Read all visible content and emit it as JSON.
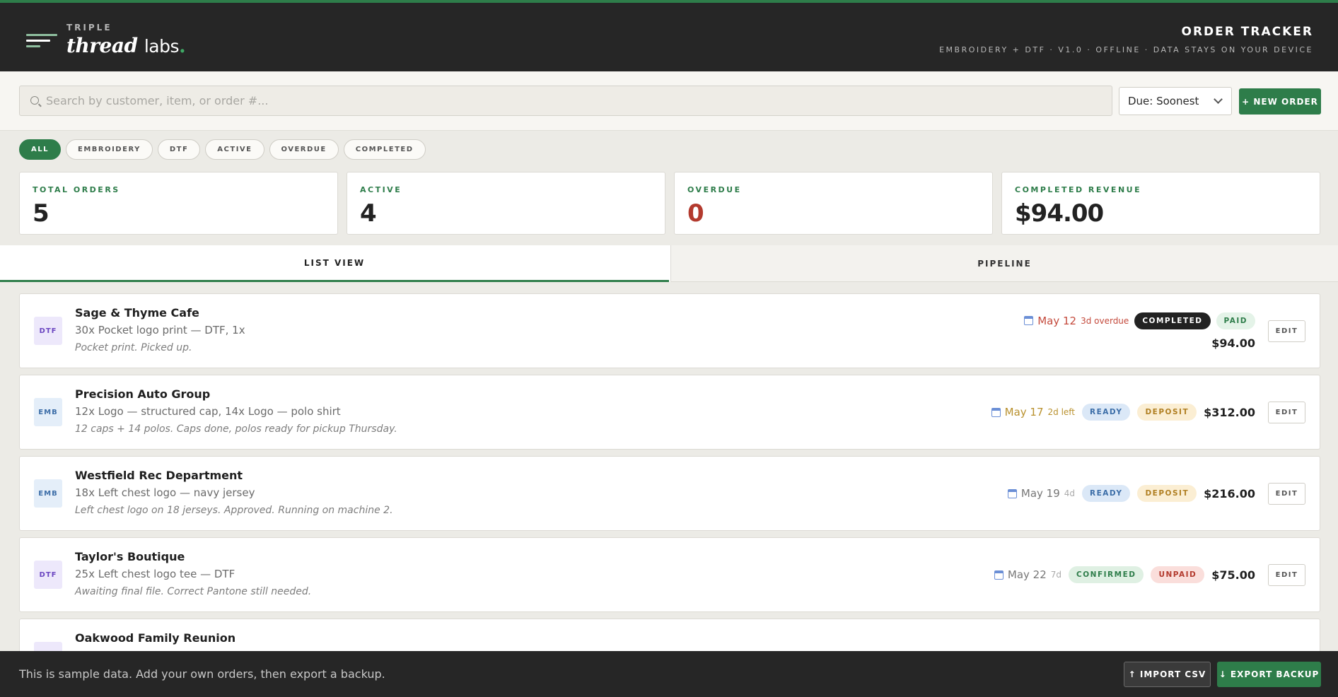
{
  "brand": {
    "top": "TRIPLE",
    "thread": "thread",
    "labs": "labs",
    "dot": "."
  },
  "header": {
    "title": "ORDER TRACKER",
    "subtitle": "EMBROIDERY + DTF · V1.0 · OFFLINE · DATA STAYS ON YOUR DEVICE"
  },
  "search": {
    "placeholder": "Search by customer, item, or order #...",
    "value": ""
  },
  "sort": {
    "selected": "Due: Soonest"
  },
  "actions": {
    "new_order": "+ NEW ORDER"
  },
  "filters": [
    "ALL",
    "EMBROIDERY",
    "DTF",
    "ACTIVE",
    "OVERDUE",
    "COMPLETED"
  ],
  "active_filter": "ALL",
  "stats": [
    {
      "label": "TOTAL ORDERS",
      "value": "5"
    },
    {
      "label": "ACTIVE",
      "value": "4"
    },
    {
      "label": "OVERDUE",
      "value": "0"
    },
    {
      "label": "COMPLETED REVENUE",
      "value": "$94.00"
    }
  ],
  "tabs": {
    "list": "LIST VIEW",
    "pipeline": "PIPELINE",
    "active": "LIST VIEW"
  },
  "orders": [
    {
      "type": "DTF",
      "customer": "Sage & Thyme Cafe",
      "items": "30x Pocket logo print — DTF, 1x",
      "note": "Pocket print. Picked up.",
      "due_date": "May 12",
      "due_rel": "3d overdue",
      "status": "COMPLETED",
      "payment": "PAID",
      "amount": "$94.00",
      "edit": "EDIT"
    },
    {
      "type": "EMB",
      "customer": "Precision Auto Group",
      "items": "12x Logo — structured cap, 14x Logo — polo shirt",
      "note": "12 caps + 14 polos. Caps done, polos ready for pickup Thursday.",
      "due_date": "May 17",
      "due_rel": "2d left",
      "status": "READY",
      "payment": "DEPOSIT",
      "amount": "$312.00",
      "edit": "EDIT"
    },
    {
      "type": "EMB",
      "customer": "Westfield Rec Department",
      "items": "18x Left chest logo — navy jersey",
      "note": "Left chest logo on 18 jerseys. Approved. Running on machine 2.",
      "due_date": "May 19",
      "due_rel": "4d",
      "status": "READY",
      "payment": "DEPOSIT",
      "amount": "$216.00",
      "edit": "EDIT"
    },
    {
      "type": "DTF",
      "customer": "Taylor's Boutique",
      "items": "25x Left chest logo tee — DTF",
      "note": "Awaiting final file. Correct Pantone still needed.",
      "due_date": "May 22",
      "due_rel": "7d",
      "status": "CONFIRMED",
      "payment": "UNPAID",
      "amount": "$75.00",
      "edit": "EDIT"
    },
    {
      "customer": "Oakwood Family Reunion"
    }
  ],
  "footer": {
    "message": "This is sample data. Add your own orders, then export a backup.",
    "import": "↑ IMPORT CSV",
    "export": "↓ EXPORT BACKUP"
  },
  "colors": {
    "accent": "#2e7d4a",
    "header_bg": "#262626",
    "overdue_red": "#b33a2e"
  }
}
